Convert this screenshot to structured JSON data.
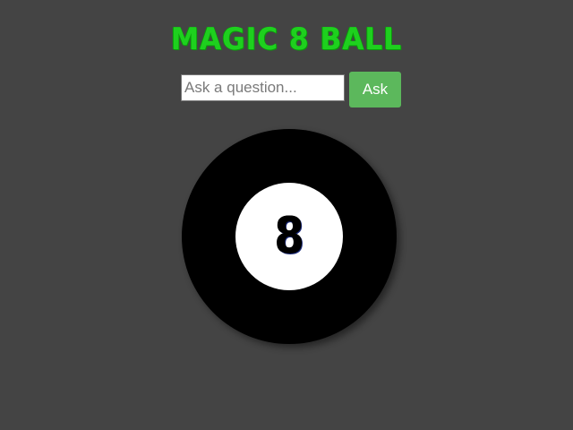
{
  "header": {
    "title": "MAGIC 8 BALL"
  },
  "form": {
    "question_placeholder": "Ask a question...",
    "question_value": "",
    "ask_label": "Ask"
  },
  "ball": {
    "display_text": "8"
  },
  "colors": {
    "background": "#444444",
    "title": "#1ed01e",
    "button": "#5cb85c",
    "ball": "#000000",
    "ball_window": "#ffffff"
  }
}
